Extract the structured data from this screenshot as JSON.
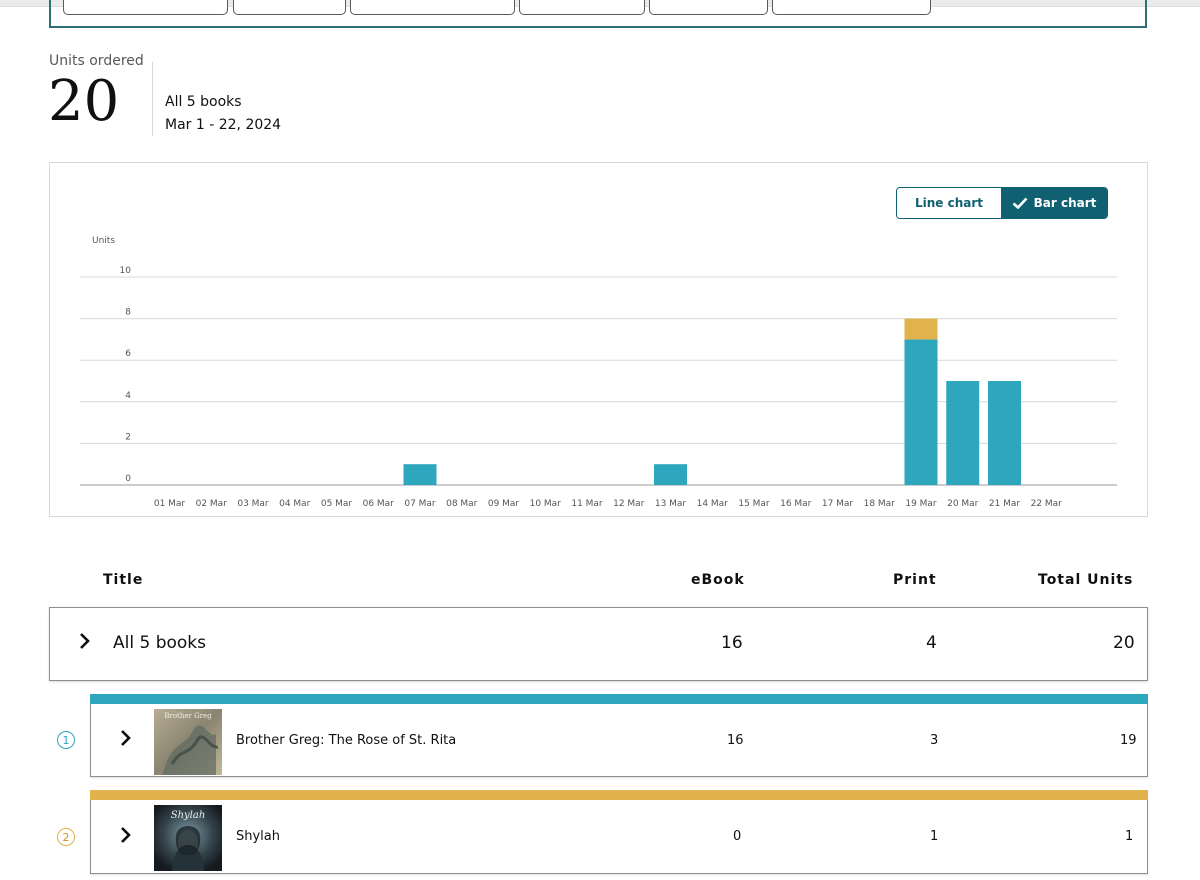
{
  "summary": {
    "label": "Units ordered",
    "total": "20",
    "scope": "All 5 books",
    "date_range": "Mar 1 - 22, 2024"
  },
  "toggle": {
    "line_label": "Line chart",
    "bar_label": "Bar chart",
    "selected": "bar"
  },
  "chart_data": {
    "type": "bar",
    "stacked": true,
    "ylabel": "Units",
    "xlabel": "",
    "ylim": [
      0,
      10
    ],
    "y_ticks": [
      0,
      2,
      4,
      6,
      8,
      10
    ],
    "grid": true,
    "categories": [
      "01 Mar",
      "02 Mar",
      "03 Mar",
      "04 Mar",
      "05 Mar",
      "06 Mar",
      "07 Mar",
      "08 Mar",
      "09 Mar",
      "10 Mar",
      "11 Mar",
      "12 Mar",
      "13 Mar",
      "14 Mar",
      "15 Mar",
      "16 Mar",
      "17 Mar",
      "18 Mar",
      "19 Mar",
      "20 Mar",
      "21 Mar",
      "22 Mar"
    ],
    "series": [
      {
        "values": [
          0,
          0,
          0,
          0,
          0,
          0,
          1,
          0,
          0,
          0,
          0,
          0,
          1,
          0,
          0,
          0,
          0,
          0,
          7,
          5,
          5,
          0
        ],
        "color": "#2ea6be"
      },
      {
        "values": [
          0,
          0,
          0,
          0,
          0,
          0,
          0,
          0,
          0,
          0,
          0,
          0,
          0,
          0,
          0,
          0,
          0,
          0,
          1,
          0,
          0,
          0
        ],
        "color": "#e2b24c"
      }
    ]
  },
  "table": {
    "headers": {
      "title": "Title",
      "ebook": "eBook",
      "print": "Print",
      "total": "Total Units"
    },
    "all_row": {
      "title": "All 5 books",
      "ebook": "16",
      "print": "4",
      "total": "20"
    },
    "books": [
      {
        "rank": "1",
        "title": "Brother Greg: The Rose of St. Rita",
        "ebook": "16",
        "print": "3",
        "total": "19",
        "color": "#2ea6be",
        "cover_text": "Brother Greg"
      },
      {
        "rank": "2",
        "title": "Shylah",
        "ebook": "0",
        "print": "1",
        "total": "1",
        "color": "#e2b24c",
        "cover_text": "Shylah"
      }
    ]
  },
  "icons": {
    "expand": "chevron-right-icon",
    "check": "check-icon"
  }
}
